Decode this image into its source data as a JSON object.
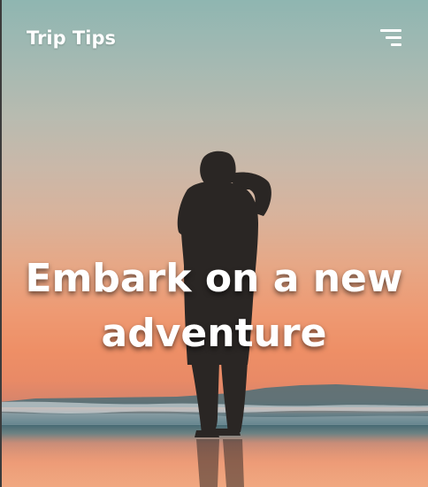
{
  "header": {
    "brand": "Trip Tips",
    "menu_icon": "hamburger-menu-icon"
  },
  "hero": {
    "headline": "Embark on a new adventure",
    "background_image": "silhouette of person taking photo on beach at sunset",
    "colors": {
      "sky_top": "#8fb6b1",
      "sky_sunset": "#ee9a73",
      "sea": "#3f6570",
      "text": "#ffffff"
    }
  }
}
